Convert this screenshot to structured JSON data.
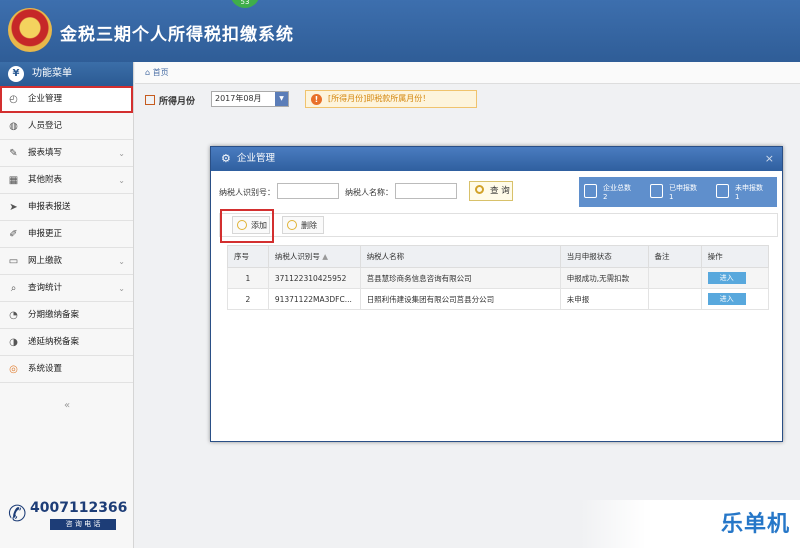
{
  "header": {
    "title": "金税三期个人所得税扣缴系统",
    "badge": "53"
  },
  "sidebar": {
    "heading": "功能菜单",
    "items": [
      {
        "label": "企业管理",
        "icon": "enterprise-icon",
        "chevron": false
      },
      {
        "label": "人员登记",
        "icon": "person-icon",
        "chevron": false
      },
      {
        "label": "报表填写",
        "icon": "edit-icon",
        "chevron": true
      },
      {
        "label": "其他附表",
        "icon": "grid-icon",
        "chevron": true
      },
      {
        "label": "申报表报送",
        "icon": "send-icon",
        "chevron": false
      },
      {
        "label": "申报更正",
        "icon": "correct-icon",
        "chevron": false
      },
      {
        "label": "网上缴款",
        "icon": "payment-icon",
        "chevron": true
      },
      {
        "label": "查询统计",
        "icon": "search-icon",
        "chevron": true
      },
      {
        "label": "分期缴纳备案",
        "icon": "installment-icon",
        "chevron": false
      },
      {
        "label": "递延纳税备案",
        "icon": "deferral-icon",
        "chevron": false
      },
      {
        "label": "系统设置",
        "icon": "settings-icon",
        "chevron": false
      }
    ],
    "collapse_glyph": "«",
    "phone": {
      "number": "4007112366",
      "label": "咨 询 电 话"
    }
  },
  "breadcrumb": {
    "home": "首页"
  },
  "filter": {
    "label": "所得月份",
    "month": "2017年08月",
    "tip": "[所得月份]即税款所属月份！"
  },
  "dialog": {
    "title": "企业管理",
    "search": {
      "taxpayer_id_label": "纳税人识别号：",
      "taxpayer_name_label": "纳税人名称：",
      "query_button": "查 询"
    },
    "stats": [
      {
        "label": "企业总数",
        "value": "2"
      },
      {
        "label": "已申报数",
        "value": "1"
      },
      {
        "label": "未申报数",
        "value": "1"
      }
    ],
    "toolbar": {
      "add": "添加",
      "delete": "删除"
    },
    "columns": [
      "序号",
      "纳税人识别号",
      "纳税人名称",
      "当月申报状态",
      "备注",
      "操作"
    ],
    "rows": [
      {
        "no": "1",
        "id": "371122310425952",
        "name": "莒县慧珍商务信息咨询有限公司",
        "status": "申报成功,无需扣款",
        "note": "",
        "action": "进入"
      },
      {
        "no": "2",
        "id": "91371122MA3DFC...",
        "name": "日照利伟建设集团有限公司莒县分公司",
        "status": "未申报",
        "note": "",
        "action": "进入"
      }
    ]
  },
  "watermark": "乐单机",
  "colors": {
    "header": "#2f5d97",
    "highlight": "#d32f2f",
    "tip": "#d4860c",
    "enter_button": "#58a8dd",
    "stats_bg": "#5f8fcc"
  }
}
